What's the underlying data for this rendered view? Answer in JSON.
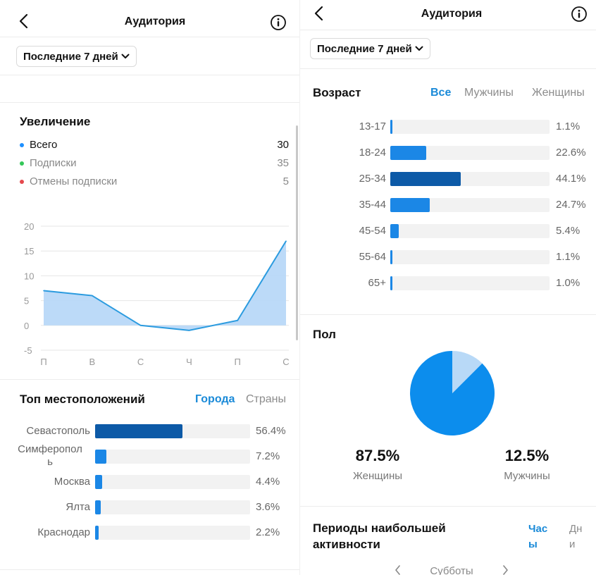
{
  "colors": {
    "accent_blue": "#1a8ad8",
    "bar_dark": "#0d5aa7",
    "bar_light": "#1b87e6",
    "pie_main": "#0c8ded",
    "pie_minor": "#b8d9f7",
    "chart_fill": "#b8d8f8",
    "chart_line": "#2b9bdf",
    "dot_total": "#1e90ff",
    "dot_follows": "#34c759",
    "dot_unfollows": "#e5484d"
  },
  "left": {
    "header": {
      "title": "Аудитория",
      "back_icon": "chevron-left-icon",
      "info_icon": "info-circle-icon"
    },
    "date_range": {
      "label": "Последние 7 дней",
      "icon": "chevron-down-icon"
    },
    "growth": {
      "title": "Увеличение",
      "legend": [
        {
          "label": "Всего",
          "value": "30",
          "color": "#1e90ff"
        },
        {
          "label": "Подписки",
          "value": "35",
          "color": "#34c759"
        },
        {
          "label": "Отмены подписки",
          "value": "5",
          "color": "#e5484d"
        }
      ]
    },
    "top_locations": {
      "title": "Топ местоположений",
      "tab_cities": "Города",
      "tab_countries": "Страны",
      "rows": [
        {
          "label": "Севастополь",
          "pct": "56.4%",
          "value": 56.4,
          "dark": true
        },
        {
          "label": "Симферопол\nь",
          "pct": "7.2%",
          "value": 7.2,
          "dark": false
        },
        {
          "label": "Москва",
          "pct": "4.4%",
          "value": 4.4,
          "dark": false
        },
        {
          "label": "Ялта",
          "pct": "3.6%",
          "value": 3.6,
          "dark": false
        },
        {
          "label": "Краснодар",
          "pct": "2.2%",
          "value": 2.2,
          "dark": false
        }
      ]
    }
  },
  "right": {
    "header": {
      "title": "Аудитория",
      "back_icon": "chevron-left-icon",
      "info_icon": "info-circle-icon"
    },
    "date_range": {
      "label": "Последние 7 дней",
      "icon": "chevron-down-icon"
    },
    "age": {
      "title": "Возраст",
      "tab_all": "Все",
      "tab_men": "Мужчины",
      "tab_women": "Женщины",
      "rows": [
        {
          "label": "13-17",
          "pct": "1.1%",
          "value": 1.1,
          "dark": false
        },
        {
          "label": "18-24",
          "pct": "22.6%",
          "value": 22.6,
          "dark": false
        },
        {
          "label": "25-34",
          "pct": "44.1%",
          "value": 44.1,
          "dark": true
        },
        {
          "label": "35-44",
          "pct": "24.7%",
          "value": 24.7,
          "dark": false
        },
        {
          "label": "45-54",
          "pct": "5.4%",
          "value": 5.4,
          "dark": false
        },
        {
          "label": "55-64",
          "pct": "1.1%",
          "value": 1.1,
          "dark": false
        },
        {
          "label": "65+",
          "pct": "1.0%",
          "value": 1.0,
          "dark": false
        }
      ]
    },
    "gender": {
      "title": "Пол",
      "women_value": "87.5%",
      "women_label": "Женщины",
      "men_value": "12.5%",
      "men_label": "Мужчины"
    },
    "activity": {
      "title_line1": "Периоды наибольшей",
      "title_line2": "активности",
      "tab_hours_1": "Час",
      "tab_hours_2": "ы",
      "tab_days_1": "Дн",
      "tab_days_2": "и",
      "day_label": "Субботы"
    }
  },
  "chart_data": [
    {
      "type": "area",
      "title": "",
      "x": [
        "П",
        "В",
        "С",
        "Ч",
        "П",
        "С"
      ],
      "series": [
        {
          "values": [
            7,
            6,
            0,
            -1,
            1,
            17
          ]
        }
      ],
      "ylim": [
        -5,
        20
      ],
      "yticks": [
        "20",
        "15",
        "10",
        "5",
        "0",
        "-5"
      ],
      "grid": true
    },
    {
      "type": "pie",
      "labels": [
        "Женщины",
        "Мужчины"
      ],
      "values": [
        87.5,
        12.5
      ]
    }
  ]
}
